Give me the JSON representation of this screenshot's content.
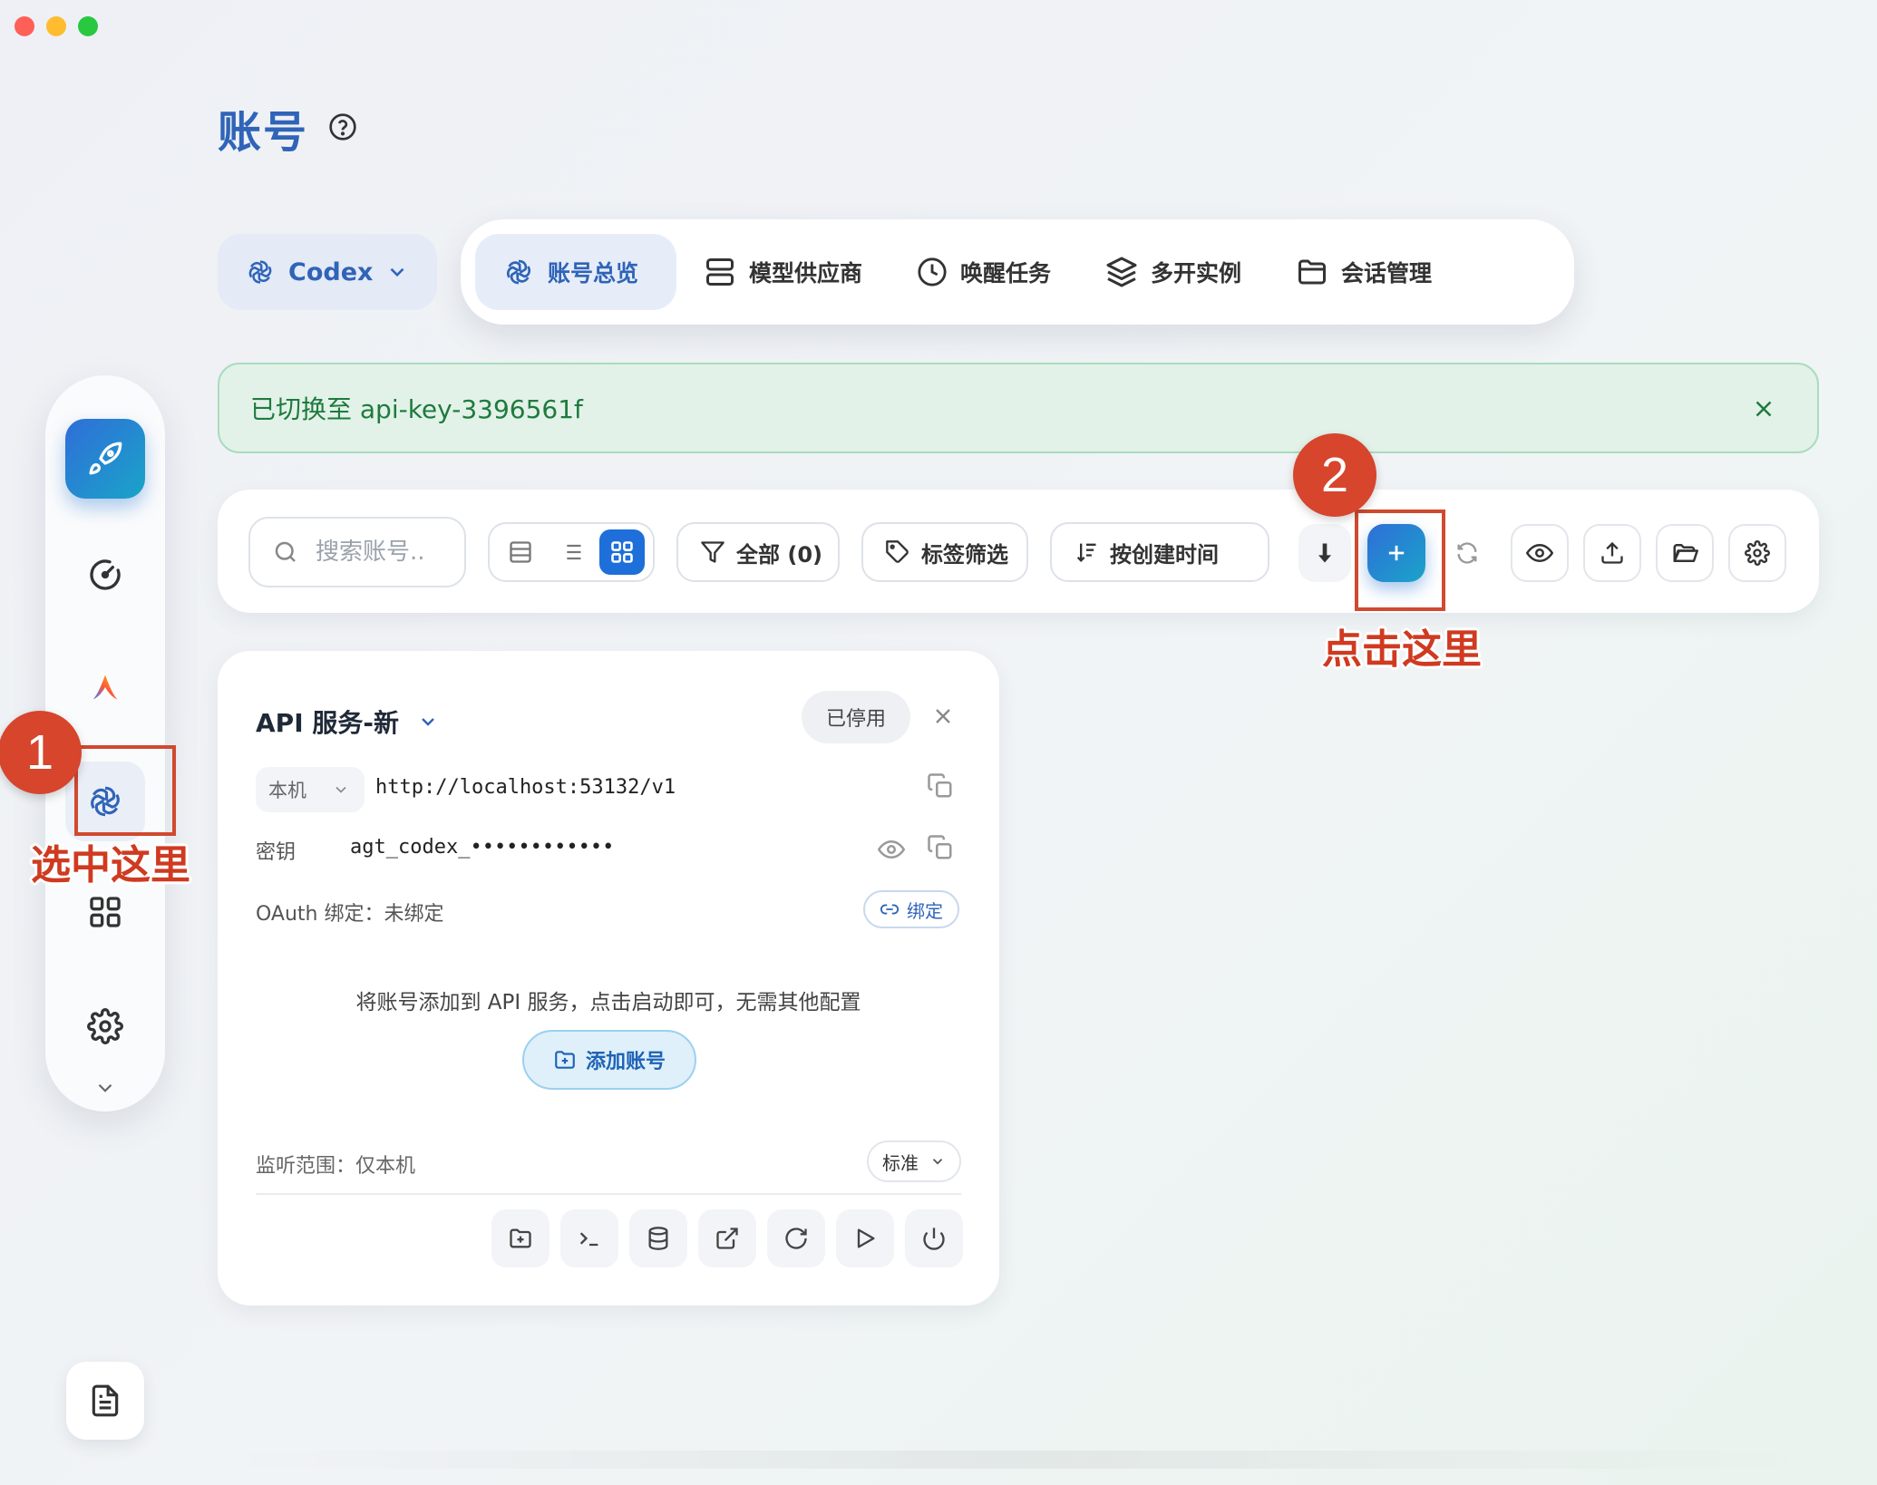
{
  "page": {
    "title": "账号"
  },
  "platform": {
    "label": "Codex"
  },
  "tabs": [
    {
      "label": "账号总览",
      "icon": "openai-icon",
      "active": true
    },
    {
      "label": "模型供应商",
      "icon": "server-icon"
    },
    {
      "label": "唤醒任务",
      "icon": "clock-icon"
    },
    {
      "label": "多开实例",
      "icon": "layers-icon"
    },
    {
      "label": "会话管理",
      "icon": "folder-icon"
    }
  ],
  "alert": {
    "message": "已切换至 api-key-3396561f"
  },
  "toolbar": {
    "search_placeholder": "搜索账号..",
    "filter_all": "全部 (0)",
    "tag_filter": "标签筛选",
    "sort": "按创建时间"
  },
  "card": {
    "title": "API 服务-新",
    "status": "已停用",
    "host": "本机",
    "url": "http://localhost:53132/v1",
    "key_label": "密钥",
    "key_value": "agt_codex_••••••••••••",
    "oauth": "OAuth 绑定：未绑定",
    "bind_label": "绑定",
    "hint": "将账号添加到 API 服务，点击启动即可，无需其他配置",
    "add_account": "添加账号",
    "listen": "监听范围：仅本机",
    "level": "标准"
  },
  "annotations": {
    "badge1": "1",
    "text1": "选中这里",
    "badge2": "2",
    "text2": "点击这里"
  },
  "colors": {
    "accent": "#2f64b8",
    "primary_button": "#1e6fd9",
    "annotation": "#d6452c",
    "alert_bg": "#e2f2e8",
    "alert_text": "#1f7a3e"
  }
}
